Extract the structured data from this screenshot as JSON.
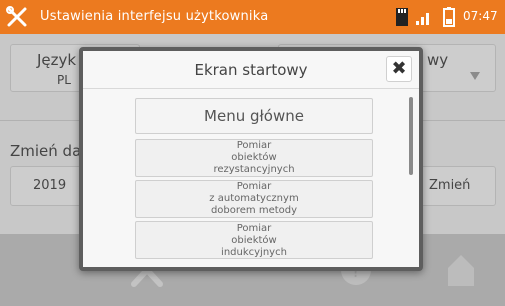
{
  "header": {
    "title": "Ustawienia interfejsu użytkownika",
    "time": "07:47",
    "accent": "#ec7a1f",
    "icons": [
      "tools-logo-icon",
      "sd-card-icon",
      "signal-icon",
      "battery-icon"
    ]
  },
  "background": {
    "language_label": "Język",
    "language_value": "PL",
    "partial_right_label": "wy",
    "change_date_label": "Zmień dat",
    "year_partial": "2019",
    "change_button": "Zmień"
  },
  "footer": {
    "icons": [
      "tools-icon",
      "help-icon",
      "home-icon"
    ]
  },
  "dialog": {
    "title": "Ekran startowy",
    "close_icon": "close-icon",
    "options": [
      {
        "lines": [
          "Menu główne"
        ]
      },
      {
        "lines": [
          "Pomiar",
          "obiektów",
          "rezystancyjnych"
        ]
      },
      {
        "lines": [
          "Pomiar",
          "z automatycznym",
          "doborem metody"
        ]
      },
      {
        "lines": [
          "Pomiar",
          "obiektów",
          "indukcyjnych"
        ]
      }
    ]
  }
}
